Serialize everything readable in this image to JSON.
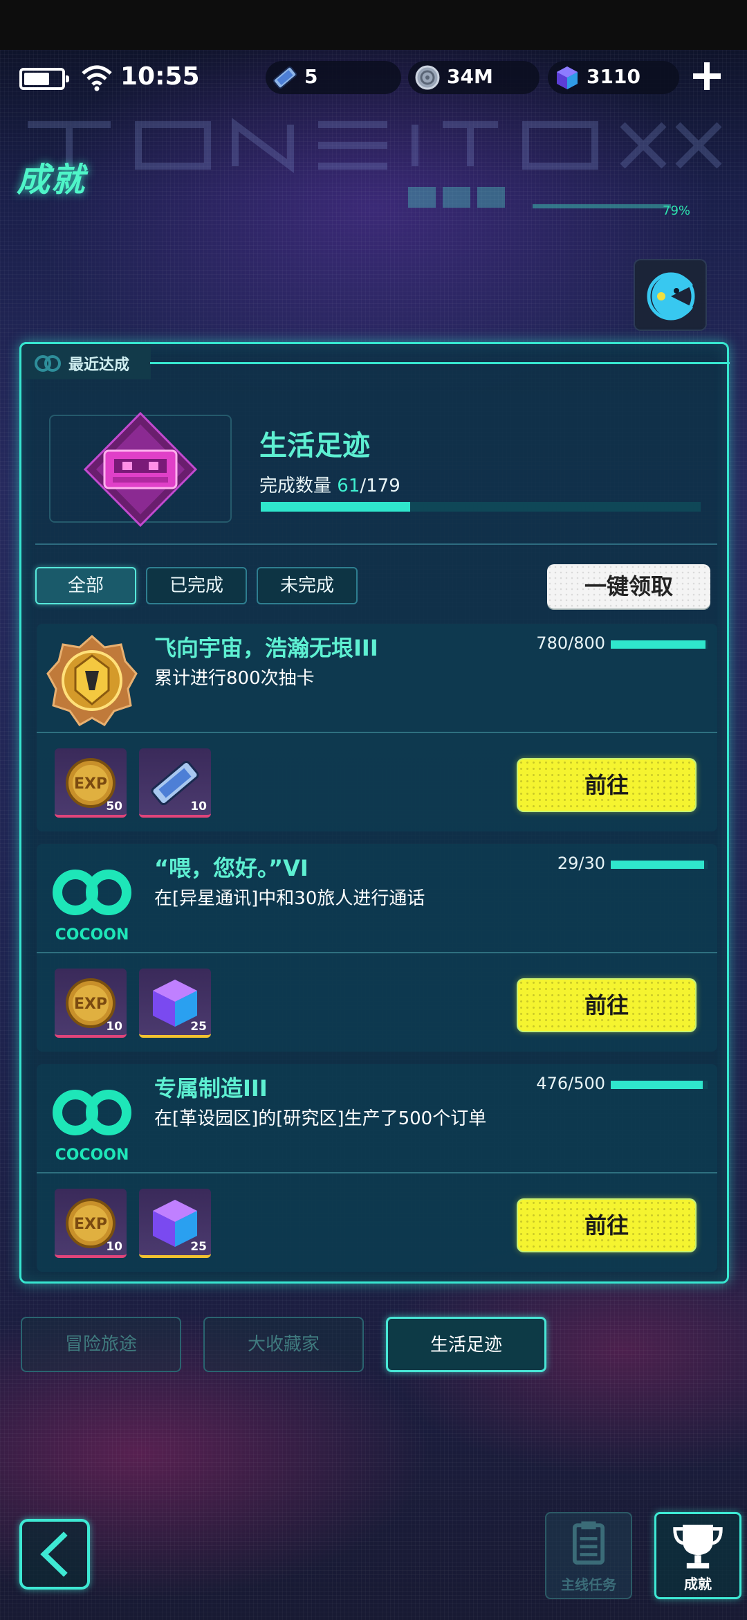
{
  "status_bar": {
    "time": "10:55",
    "tickets": "5",
    "coins": "34M",
    "gems": "3110"
  },
  "page_title": "成就",
  "title_progress": "79%",
  "panel": {
    "recent_label": "最近达成",
    "category_title": "生活足迹",
    "count_label": "完成数量",
    "count_current": "61",
    "count_total": "/179",
    "progress_fraction": 0.34
  },
  "filters": [
    "全部",
    "已完成",
    "未完成"
  ],
  "claim_all_label": "一键领取",
  "achievements": [
    {
      "name": "飞向宇宙，浩瀚无垠III",
      "desc": "累计进行800次抽卡",
      "progress_text": "780/800",
      "progress_fraction": 0.975,
      "icon": "gold-medal-icon",
      "rewards": [
        {
          "icon": "exp-coin-icon",
          "qty": "50",
          "rarity": "pink"
        },
        {
          "icon": "ticket-icon",
          "qty": "10",
          "rarity": "pink"
        }
      ],
      "button": "前往"
    },
    {
      "name": "“喂，您好。”VI",
      "desc": "在[异星通讯]中和30旅人进行通话",
      "progress_text": "29/30",
      "progress_fraction": 0.967,
      "icon": "cocoon-logo-icon",
      "logo_text": "COCOON",
      "rewards": [
        {
          "icon": "exp-coin-icon",
          "qty": "10",
          "rarity": "pink"
        },
        {
          "icon": "cube-icon",
          "qty": "25",
          "rarity": "gold"
        }
      ],
      "button": "前往"
    },
    {
      "name": "专属制造III",
      "desc": "在[革设园区]的[研究区]生产了500个订单",
      "progress_text": "476/500",
      "progress_fraction": 0.952,
      "icon": "cocoon-logo-icon",
      "logo_text": "COCOON",
      "rewards": [
        {
          "icon": "exp-coin-icon",
          "qty": "10",
          "rarity": "pink"
        },
        {
          "icon": "cube-icon",
          "qty": "25",
          "rarity": "gold"
        }
      ],
      "button": "前往"
    }
  ],
  "category_tabs": [
    "冒险旅途",
    "大收藏家",
    "生活足迹"
  ],
  "bottom_nav": {
    "main_quest": "主线任务",
    "achievements": "成就"
  },
  "colors": {
    "accent": "#37e6d0",
    "title": "#5ef0d2",
    "go_button": "#f5f430"
  }
}
